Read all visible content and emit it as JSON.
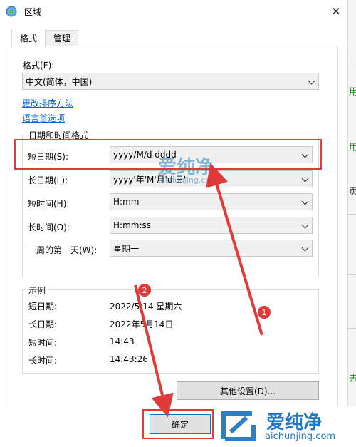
{
  "window": {
    "title": "区域"
  },
  "tabs": {
    "format": "格式",
    "manage": "管理"
  },
  "format_section": {
    "label": "格式(F):",
    "value": "中文(简体，中国)",
    "link_sort": "更改排序方法",
    "link_lang": "语言首选项"
  },
  "datetime_group": {
    "title": "日期和时间格式",
    "rows": [
      {
        "label": "短日期(S):",
        "value": "yyyy/M/d dddd"
      },
      {
        "label": "长日期(L):",
        "value": "yyyy'年'M'月'd'日'"
      },
      {
        "label": "短时间(H):",
        "value": "H:mm"
      },
      {
        "label": "长时间(O):",
        "value": "H:mm:ss"
      },
      {
        "label": "一周的第一天(W):",
        "value": "星期一"
      }
    ]
  },
  "example_group": {
    "title": "示例",
    "rows": [
      {
        "label": "短日期:",
        "value": "2022/5/14 星期六"
      },
      {
        "label": "长日期:",
        "value": "2022年5月14日"
      },
      {
        "label": "短时间:",
        "value": "14:43"
      },
      {
        "label": "长时间:",
        "value": "14:43:26"
      }
    ]
  },
  "buttons": {
    "other_settings": "其他设置(D)...",
    "ok": "确定"
  },
  "annotations": {
    "badge1": "1",
    "badge2": "2"
  },
  "watermark": {
    "brand": "爱纯净",
    "site": "aichunjing.com"
  },
  "background_app": {
    "chars": [
      "用",
      "用",
      "页",
      "去"
    ]
  },
  "colors": {
    "annotation_red": "#e03a3a",
    "link_blue": "#0a64c8",
    "watermark_blue": "#2b7fc4"
  }
}
